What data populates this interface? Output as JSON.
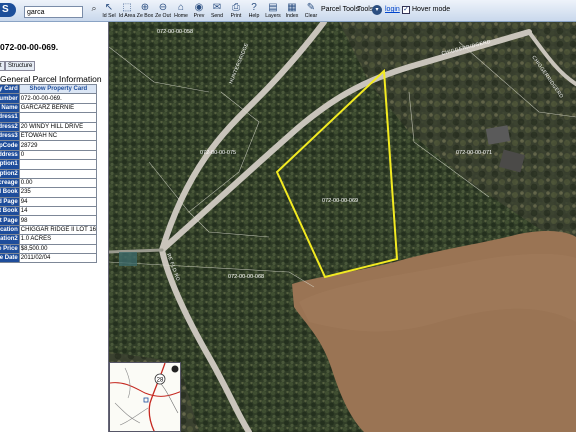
{
  "toolbar": {
    "logo": "S",
    "search_value": "garca",
    "search_label": "",
    "tools": [
      {
        "icon": "id-sel-icon",
        "glyph": "↖",
        "label": "Id Sel"
      },
      {
        "icon": "id-area-icon",
        "glyph": "⬚",
        "label": "Id Area"
      },
      {
        "icon": "zoom-box-icon",
        "glyph": "⊕",
        "label": "Ze Box"
      },
      {
        "icon": "zoom-out-icon",
        "glyph": "⊖",
        "label": "Ze Out"
      },
      {
        "icon": "home-icon",
        "glyph": "⌂",
        "label": "Home"
      },
      {
        "icon": "prev-icon",
        "glyph": "◉",
        "label": "Prev"
      },
      {
        "icon": "send-icon",
        "glyph": "✉",
        "label": "Send"
      },
      {
        "icon": "print-icon",
        "glyph": "⎙",
        "label": "Print"
      },
      {
        "icon": "help-icon",
        "glyph": "?",
        "label": "Help"
      },
      {
        "icon": "layers-icon",
        "glyph": "▤",
        "label": "Layers"
      },
      {
        "icon": "index-icon",
        "glyph": "▦",
        "label": "Index"
      },
      {
        "icon": "clear-icon",
        "glyph": "✎",
        "label": "Clear"
      }
    ],
    "parcel_tools": "Parcel Tools",
    "tools_label": "Tools",
    "login": "login",
    "hover_mode": "Hover mode",
    "hover_checked": true
  },
  "panel": {
    "parcel_id": "072-00-00-069.",
    "tabs": [
      "t",
      "Structure"
    ],
    "section_title": "General Parcel Information",
    "rows": [
      {
        "label": "ty Card",
        "value": "Show Property Card"
      },
      {
        "label": "Number",
        "value": "072-00-00-069."
      },
      {
        "label": "r Name",
        "value": "GARCARZ BERNIE"
      },
      {
        "label": "ddress1",
        "value": ""
      },
      {
        "label": "ddress2",
        "value": "20 WINDY HILL DRIVE"
      },
      {
        "label": "ddress3",
        "value": "ETOWAH NC"
      },
      {
        "label": "ZipCode",
        "value": "28729"
      },
      {
        "label": "Address",
        "value": "0"
      },
      {
        "label": "ription1",
        "value": ""
      },
      {
        "label": "ription2",
        "value": ""
      },
      {
        "label": "Acreage",
        "value": "0.00"
      },
      {
        "label": "ed Book",
        "value": "235"
      },
      {
        "label": "ed Page",
        "value": "94"
      },
      {
        "label": "at Book",
        "value": "14"
      },
      {
        "label": "at Page",
        "value": "98"
      },
      {
        "label": "ocation",
        "value": "CHIGGAR RIDGE II LOT 16"
      },
      {
        "label": "ocation2",
        "value": "1.0 ACRES"
      },
      {
        "label": "e Price",
        "value": "$8,500.00"
      },
      {
        "label": "le Date",
        "value": "2011/02/04"
      }
    ]
  },
  "map": {
    "parcel_labels": [
      "072-00-00-058",
      "072-00-00-075",
      "072-00-00-069",
      "072-00-00-071",
      "072-00-00-068"
    ],
    "road_labels": [
      "HUNTERSRIDGE",
      "CHIGGERRIDGERD",
      "RE FLD RD",
      "CHIGGERRIDGERD"
    ],
    "overview_route": "28",
    "colors": {
      "forest": "#2d3b25",
      "lake": "#9b7556",
      "road": "#c9c4bb",
      "selected": "#f2ea22"
    }
  }
}
